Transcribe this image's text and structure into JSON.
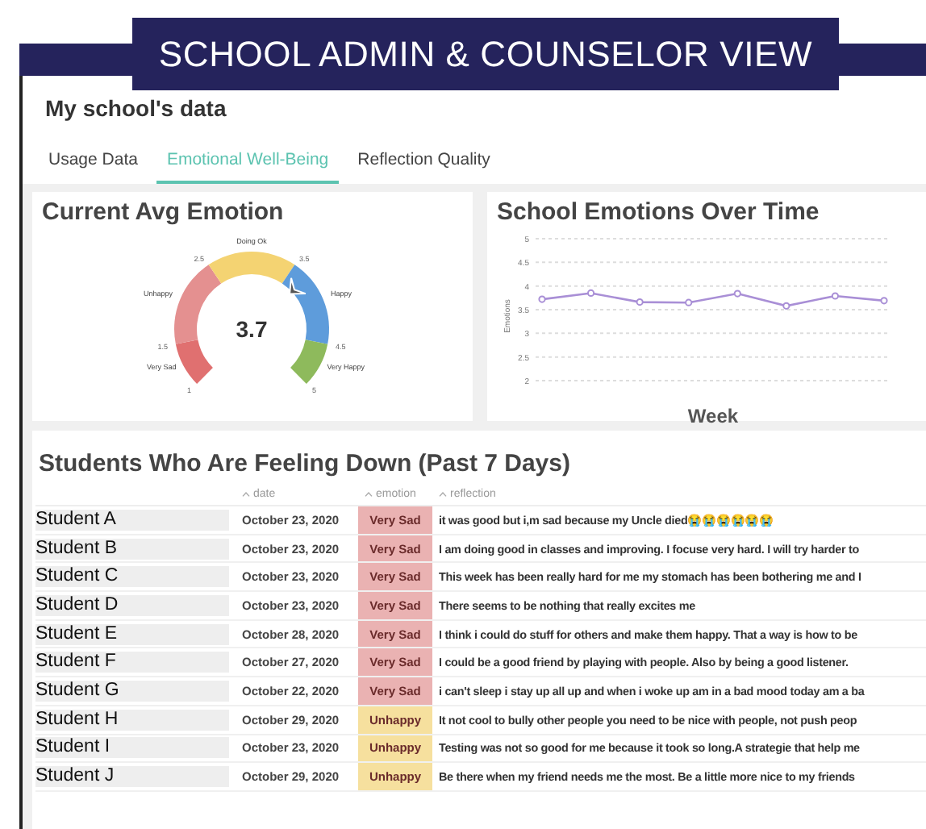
{
  "banner": {
    "title": "SCHOOL ADMIN & COUNSELOR VIEW"
  },
  "page": {
    "title": "My school's data"
  },
  "tabs": [
    {
      "label": "Usage Data",
      "selected": false
    },
    {
      "label": "Emotional Well-Being",
      "selected": true
    },
    {
      "label": "Reflection Quality",
      "selected": false
    }
  ],
  "gauge": {
    "title": "Current Avg Emotion",
    "value": "3.7",
    "level": 0.675,
    "segments": [
      {
        "label": "Very Sad",
        "color": "#e07070"
      },
      {
        "label": "Unhappy",
        "color": "#e49090"
      },
      {
        "label": "Doing Ok",
        "color": "#f4d372"
      },
      {
        "label": "Happy",
        "color": "#5e9cdb"
      },
      {
        "label": "Very Happy",
        "color": "#8eba5c"
      }
    ],
    "ticks": [
      "1",
      "1.5",
      "2.5",
      "3.5",
      "4.5",
      "5"
    ]
  },
  "trend": {
    "title": "School Emotions Over Time",
    "chart_data": {
      "type": "line",
      "xlabel": "Week",
      "ylabel": "Emotions",
      "ylim": [
        2,
        5
      ],
      "yticks": [
        2,
        2.5,
        3,
        3.5,
        4,
        4.5,
        5
      ],
      "grid": true,
      "marker": "circle",
      "series": [
        {
          "color": "#a98fd6",
          "values": [
            3.72,
            3.85,
            3.66,
            3.65,
            3.84,
            3.58,
            3.79,
            3.69
          ]
        }
      ]
    }
  },
  "students": {
    "title": "Students Who Are Feeling Down (Past 7 Days)",
    "columns": [
      "date",
      "emotion",
      "reflection"
    ],
    "rows": [
      {
        "name": "Student A",
        "date": "October 23, 2020",
        "emotion": "Very Sad",
        "color": "#eab2b2",
        "reflection": "it was good but i,m sad because my Uncle died😭😭😭😭😭😭"
      },
      {
        "name": "Student B",
        "date": "October 23, 2020",
        "emotion": "Very Sad",
        "color": "#eab2b2",
        "reflection": "I am doing good in classes and improving. I focuse very hard. I will try harder to"
      },
      {
        "name": "Student C",
        "date": "October 23, 2020",
        "emotion": "Very Sad",
        "color": "#eab2b2",
        "reflection": "This week has been really hard for me my stomach has been bothering me and I"
      },
      {
        "name": "Student D",
        "date": "October 23, 2020",
        "emotion": "Very Sad",
        "color": "#eab2b2",
        "reflection": "There seems to be nothing that really excites me"
      },
      {
        "name": "Student E",
        "date": "October 28, 2020",
        "emotion": "Very Sad",
        "color": "#eab2b2",
        "reflection": "I think i could do stuff for others and make them happy. That a way is how to be"
      },
      {
        "name": "Student F",
        "date": "October 27, 2020",
        "emotion": "Very Sad",
        "color": "#eab2b2",
        "reflection": "I could be a good friend by playing with people. Also by being a good listener."
      },
      {
        "name": "Student G",
        "date": "October 22, 2020",
        "emotion": "Very Sad",
        "color": "#eab2b2",
        "reflection": "i can't sleep i stay up all up and when i woke up am in a bad mood today am a ba"
      },
      {
        "name": "Student H",
        "date": "October 29, 2020",
        "emotion": "Unhappy",
        "color": "#f6e09e",
        "reflection": "It not cool to bully other people you need to be nice with people, not push peop"
      },
      {
        "name": "Student I",
        "date": "October 23, 2020",
        "emotion": "Unhappy",
        "color": "#f6e09e",
        "reflection": "Testing was not so good for me because it took so long.A strategie that help me"
      },
      {
        "name": "Student J",
        "date": "October 29, 2020",
        "emotion": "Unhappy",
        "color": "#f6e09e",
        "reflection": "Be there when my friend needs me the most. Be a little more nice to my friends"
      }
    ]
  }
}
